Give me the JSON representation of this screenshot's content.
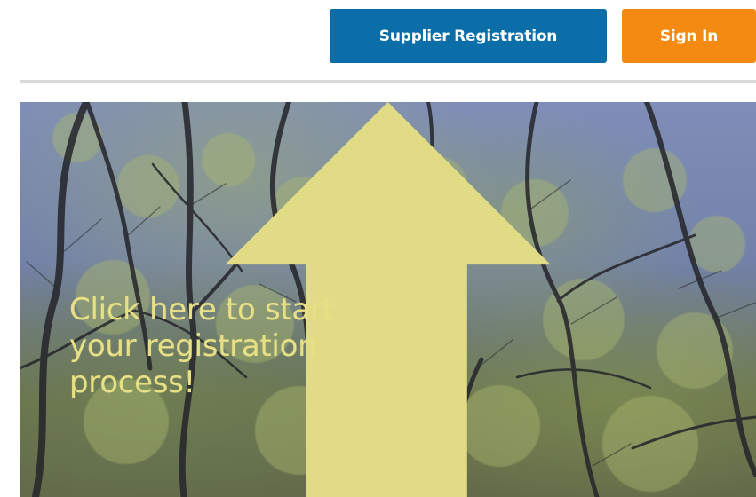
{
  "header": {
    "supplier_registration_label": "Supplier Registration",
    "sign_in_label": "Sign In"
  },
  "hero": {
    "message": "Click here to start your registration process!",
    "background_icon": "tree-branches-image",
    "arrow_icon": "up-arrow-icon"
  },
  "colors": {
    "supplier_button": "#0b6ea8",
    "sign_in_button": "#f48a12",
    "arrow": "#e1db86",
    "hero_text": "#e8e084"
  }
}
